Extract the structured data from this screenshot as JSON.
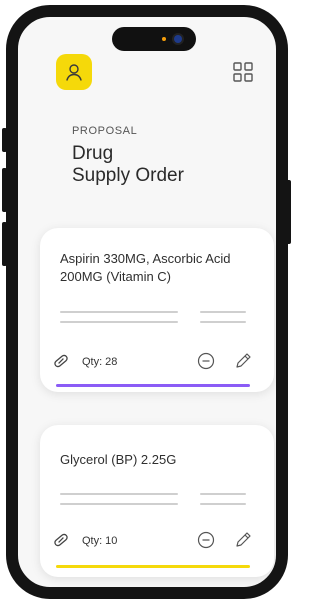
{
  "header": {
    "profile_icon": "user-icon",
    "menu_icon": "grid-icon",
    "accent_color": "#F5D90A"
  },
  "proposal": {
    "eyebrow": "PROPOSAL",
    "title_line1": "Drug",
    "title_line2": "Supply Order"
  },
  "items": [
    {
      "name": "Aspirin 330MG, Ascorbic Acid 200MG (Vitamin C)",
      "qty_label": "Qty:",
      "qty_value": "28",
      "accent_color": "#8B5CF6",
      "icons": [
        "pill-icon",
        "minus-circle-icon",
        "pencil-icon"
      ]
    },
    {
      "name": "Glycerol (BP) 2.25G",
      "qty_label": "Qty:",
      "qty_value": "10",
      "accent_color": "#F5D90A",
      "icons": [
        "pill-icon",
        "minus-circle-icon",
        "pencil-icon"
      ]
    }
  ]
}
